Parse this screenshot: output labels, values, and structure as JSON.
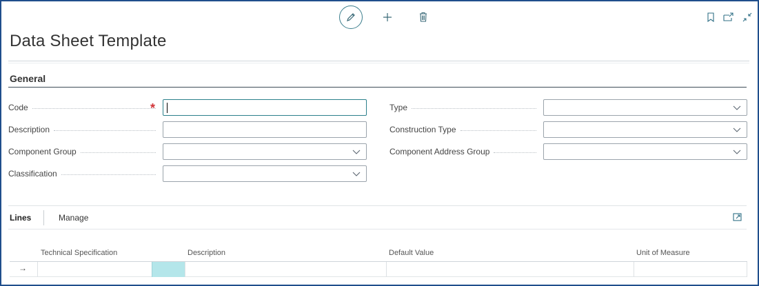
{
  "page": {
    "title": "Data Sheet Template"
  },
  "actions": {
    "edit_icon": "pencil-icon",
    "new_icon": "plus-icon",
    "delete_icon": "trash-icon",
    "bookmark_icon": "bookmark-icon",
    "open_new_window_icon": "open-new-window-icon",
    "collapse_icon": "collapse-icon"
  },
  "general": {
    "title": "General",
    "fields": {
      "code": {
        "label": "Code",
        "value": "",
        "required": true
      },
      "description": {
        "label": "Description",
        "value": ""
      },
      "component_group": {
        "label": "Component Group",
        "value": ""
      },
      "classification": {
        "label": "Classification",
        "value": ""
      },
      "type": {
        "label": "Type",
        "value": ""
      },
      "construction_type": {
        "label": "Construction Type",
        "value": ""
      },
      "component_address_group": {
        "label": "Component Address Group",
        "value": ""
      }
    }
  },
  "lines": {
    "tabs": [
      "Lines",
      "Manage"
    ],
    "active_tab": "Lines",
    "columns": [
      "Technical Specification",
      "Description",
      "Default Value",
      "Unit of Measure"
    ],
    "rows": [
      {
        "marker": "→",
        "technical_specification": "",
        "description": "",
        "default_value": "",
        "unit_of_measure": ""
      }
    ]
  },
  "colors": {
    "frame": "#1f4e8c",
    "accent": "#2a7f8a",
    "required": "#d13438",
    "active_cell": "#b4e6ea"
  }
}
